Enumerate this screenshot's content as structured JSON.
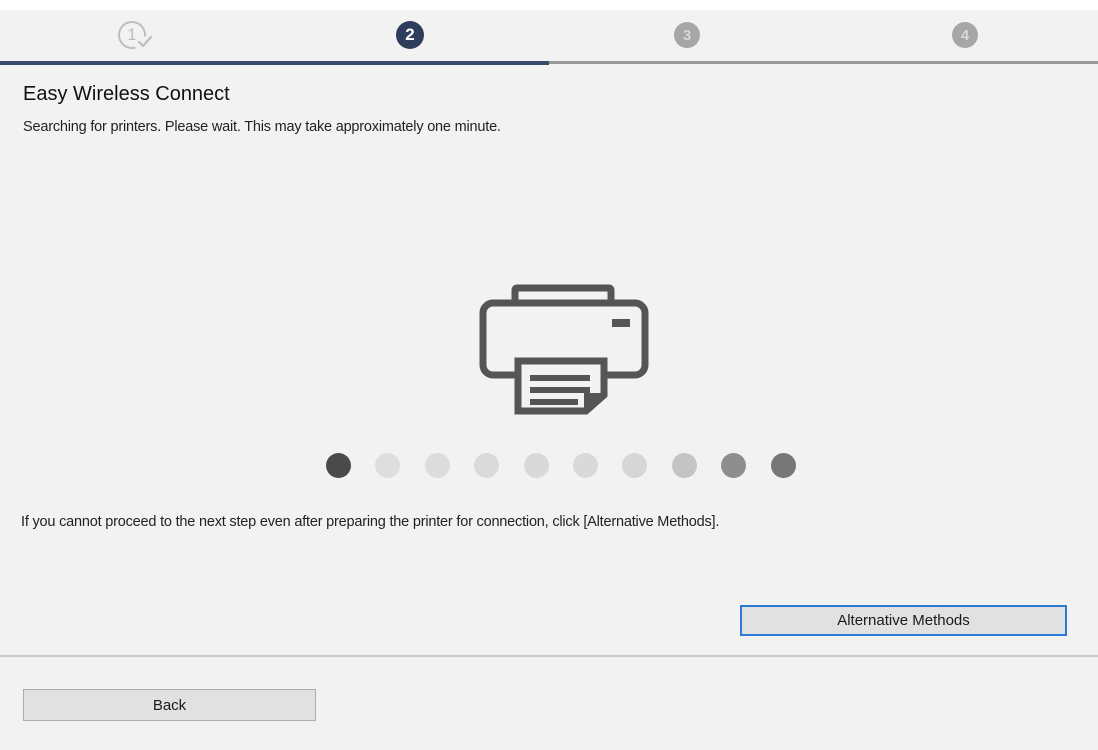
{
  "wizard": {
    "steps": [
      {
        "number": "1",
        "state": "completed",
        "icon": "step-complete-check-icon"
      },
      {
        "number": "2",
        "state": "current"
      },
      {
        "number": "3",
        "state": "upcoming"
      },
      {
        "number": "4",
        "state": "upcoming"
      }
    ],
    "progress_fraction": 0.5,
    "colors": {
      "current_step": "#2f3d5c",
      "upcoming_step": "#a6a6a6",
      "completed_step": "#bdbdbd",
      "progress_fill": "#3a4a6a",
      "focus_border": "#2b7bd4"
    }
  },
  "main": {
    "title": "Easy Wireless Connect",
    "subtitle": "Searching for printers. Please wait. This may take approximately one minute.",
    "illustration": "printer-icon",
    "loading_indicator": {
      "dot_count": 10,
      "dot_colors": [
        "#4a4a4a",
        "#dedede",
        "#dcdcdc",
        "#dadada",
        "#d9d9d9",
        "#d9d9d9",
        "#d6d6d6",
        "#c4c4c4",
        "#8e8e8e",
        "#777777"
      ]
    },
    "help_text": "If you cannot proceed to the next step even after preparing the printer for connection, click [Alternative Methods]."
  },
  "buttons": {
    "alternative_methods": "Alternative Methods",
    "back": "Back"
  }
}
